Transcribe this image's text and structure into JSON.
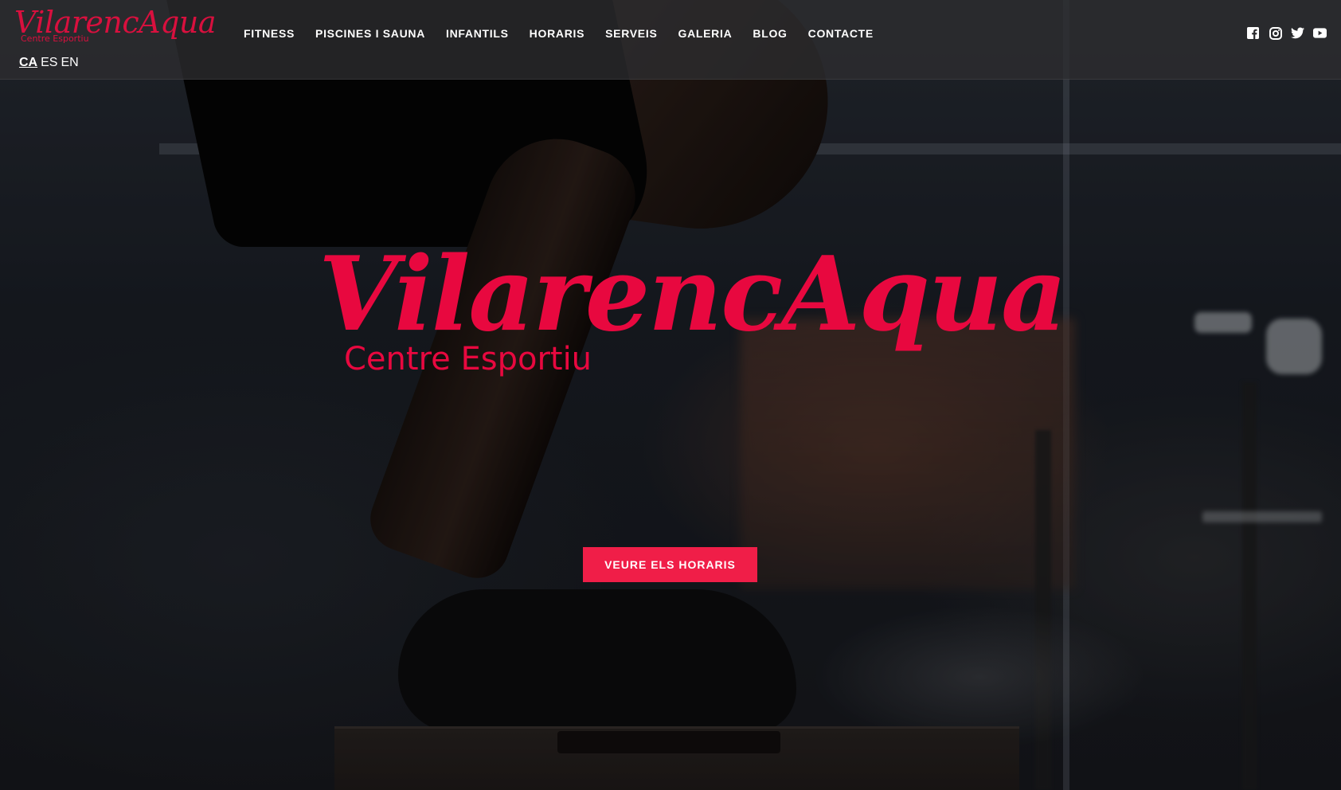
{
  "header": {
    "logo": {
      "title": "VilarencAqua",
      "subtitle": "Centre Esportiu"
    },
    "nav": [
      {
        "label": "FITNESS"
      },
      {
        "label": "PISCINES I SAUNA"
      },
      {
        "label": "INFANTILS"
      },
      {
        "label": "HORARIS"
      },
      {
        "label": "SERVEIS"
      },
      {
        "label": "GALERIA"
      },
      {
        "label": "BLOG"
      },
      {
        "label": "CONTACTE"
      }
    ],
    "languages": [
      {
        "label": "CA",
        "active": true
      },
      {
        "label": "ES",
        "active": false
      },
      {
        "label": "EN",
        "active": false
      }
    ],
    "social": [
      {
        "icon": "facebook-icon"
      },
      {
        "icon": "instagram-icon"
      },
      {
        "icon": "twitter-icon"
      },
      {
        "icon": "youtube-icon"
      }
    ]
  },
  "hero": {
    "title": "VilarencAqua",
    "subtitle": "Centre Esportiu",
    "cta_label": "VEURE ELS HORARIS"
  },
  "colors": {
    "brand": "#e8083f",
    "button": "#f01e48",
    "header_bg": "#2d2d30",
    "text": "#ffffff"
  }
}
